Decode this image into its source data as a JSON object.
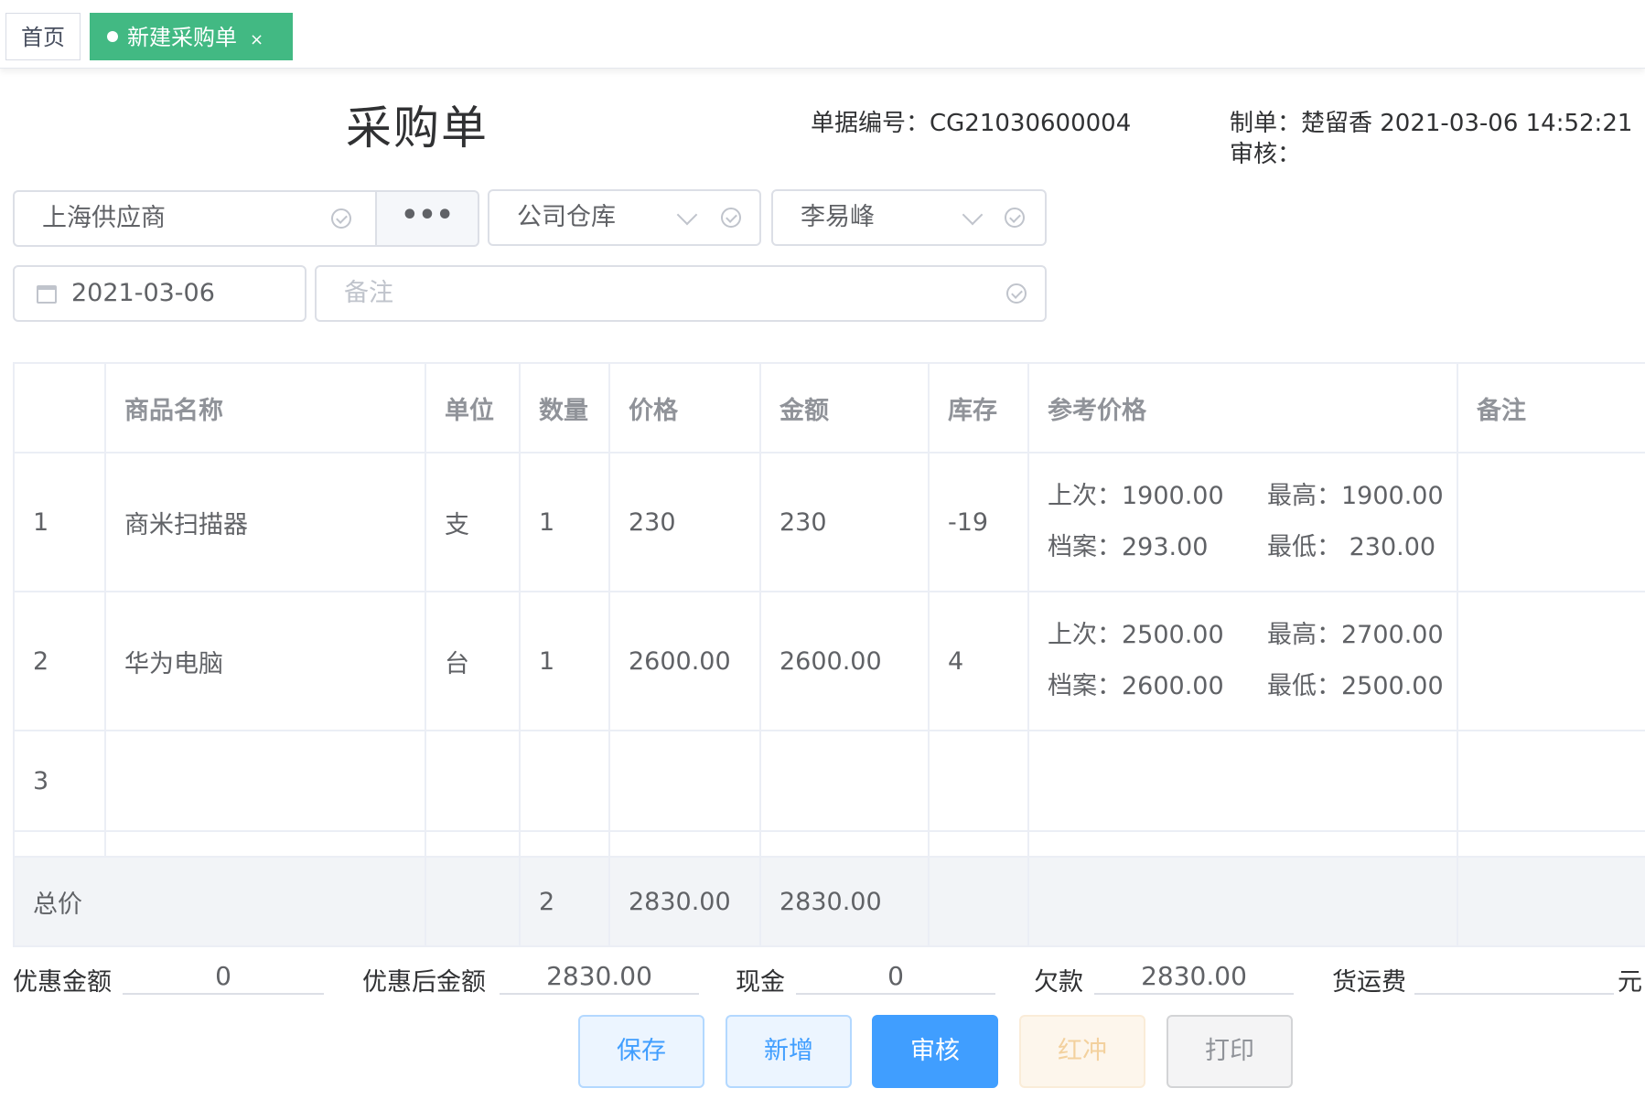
{
  "tabs": {
    "home": "首页",
    "active": "新建采购单",
    "close": "×"
  },
  "header": {
    "title": "采购单",
    "doc_no": "单据编号：CG21030600004",
    "maker": "制单：楚留香 2021-03-06 14:52:21",
    "auditor": "审核："
  },
  "form": {
    "supplier": "上海供应商",
    "supplier_more": "•••",
    "warehouse": "公司仓库",
    "handler": "李易峰",
    "date": "2021-03-06",
    "remark_placeholder": "备注"
  },
  "table": {
    "headers": [
      "",
      "商品名称",
      "单位",
      "数量",
      "价格",
      "金额",
      "库存",
      "参考价格",
      "备注"
    ],
    "rows": [
      {
        "index": "1",
        "name": "商米扫描器",
        "unit": "支",
        "qty": "1",
        "price": "230",
        "amount": "230",
        "stock": "-19",
        "ref_last": "上次：1900.00",
        "ref_max": "最高：1900.00",
        "ref_file": "档案：293.00",
        "ref_min": "最低：  230.00",
        "remark": ""
      },
      {
        "index": "2",
        "name": "华为电脑",
        "unit": "台",
        "qty": "1",
        "price": "2600.00",
        "amount": "2600.00",
        "stock": "4",
        "ref_last": "上次：2500.00",
        "ref_max": "最高：2700.00",
        "ref_file": "档案：2600.00",
        "ref_min": "最低：2500.00",
        "remark": ""
      },
      {
        "index": "3"
      }
    ],
    "total": {
      "label": "总价",
      "qty": "2",
      "price": "2830.00",
      "amount": "2830.00"
    }
  },
  "footer": {
    "discount_label": "优惠金额",
    "discount": "0",
    "after_discount_label": "优惠后金额",
    "after_discount": "2830.00",
    "cash_label": "现金",
    "cash": "0",
    "debt_label": "欠款",
    "debt": "2830.00",
    "freight_label": "货运费",
    "freight": "",
    "unit": "元"
  },
  "buttons": {
    "save": "保存",
    "new": "新增",
    "audit": "审核",
    "red": "红冲",
    "print": "打印"
  },
  "colors": {
    "tab_active": "#42b983",
    "primary": "#409eff",
    "total_row_bg": "#f2f4f7"
  }
}
